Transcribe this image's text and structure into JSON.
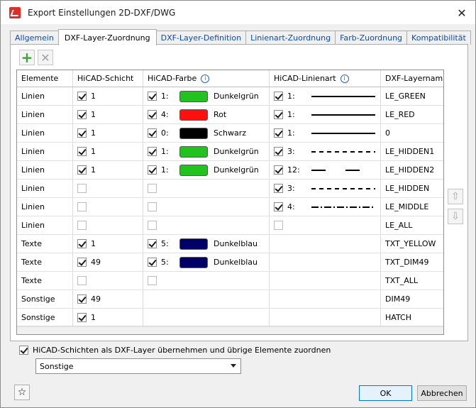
{
  "window": {
    "title": "Export Einstellungen 2D-DXF/DWG",
    "close_glyph": "✕"
  },
  "tabs": [
    "Allgemein",
    "DXF-Layer-Zuordnung",
    "DXF-Layer-Definition",
    "Linienart-Zuordnung",
    "Farb-Zuordnung",
    "Kompatibilität"
  ],
  "active_tab": "DXF-Layer-Zuordnung",
  "toolbar": {
    "add_icon": "plus-icon",
    "delete_icon": "x-icon",
    "add_glyph": "+",
    "delete_glyph": "✕"
  },
  "columns": [
    "Elemente",
    "HiCAD-Schicht",
    "HiCAD-Farbe",
    "HiCAD-Linienart",
    "DXF-Layernam"
  ],
  "info_glyph": "i",
  "rows": [
    {
      "element": "Linien",
      "layer_on": true,
      "layer": "1",
      "color_on": true,
      "color_idx": "1:",
      "color_hex": "#22c21f",
      "color_name": "Dunkelgrün",
      "line_on": true,
      "line_idx": "1:",
      "line_style": "solid",
      "dxf": "LE_GREEN"
    },
    {
      "element": "Linien",
      "layer_on": true,
      "layer": "1",
      "color_on": true,
      "color_idx": "4:",
      "color_hex": "#ff1010",
      "color_name": "Rot",
      "line_on": true,
      "line_idx": "1:",
      "line_style": "solid",
      "dxf": "LE_RED"
    },
    {
      "element": "Linien",
      "layer_on": true,
      "layer": "1",
      "color_on": true,
      "color_idx": "0:",
      "color_hex": "#000000",
      "color_name": "Schwarz",
      "line_on": true,
      "line_idx": "1:",
      "line_style": "solid",
      "dxf": "0"
    },
    {
      "element": "Linien",
      "layer_on": true,
      "layer": "1",
      "color_on": true,
      "color_idx": "1:",
      "color_hex": "#22c21f",
      "color_name": "Dunkelgrün",
      "line_on": true,
      "line_idx": "3:",
      "line_style": "dashed",
      "dxf": "LE_HIDDEN1"
    },
    {
      "element": "Linien",
      "layer_on": true,
      "layer": "1",
      "color_on": true,
      "color_idx": "1:",
      "color_hex": "#22c21f",
      "color_name": "Dunkelgrün",
      "line_on": true,
      "line_idx": "12:",
      "line_style": "longdash",
      "dxf": "LE_HIDDEN2"
    },
    {
      "element": "Linien",
      "layer_on": false,
      "layer": "",
      "color_on": false,
      "color_idx": "",
      "color_hex": "",
      "color_name": "",
      "line_on": true,
      "line_idx": "3:",
      "line_style": "dashed",
      "dxf": "LE_HIDDEN"
    },
    {
      "element": "Linien",
      "layer_on": false,
      "layer": "",
      "color_on": false,
      "color_idx": "",
      "color_hex": "",
      "color_name": "",
      "line_on": true,
      "line_idx": "4:",
      "line_style": "dashdot",
      "dxf": "LE_MIDDLE"
    },
    {
      "element": "Linien",
      "layer_on": false,
      "layer": "",
      "color_on": false,
      "color_idx": "",
      "color_hex": "",
      "color_name": "",
      "line_on": false,
      "line_idx": "",
      "line_style": "",
      "dxf": "LE_ALL"
    },
    {
      "element": "Texte",
      "layer_on": true,
      "layer": "1",
      "color_on": true,
      "color_idx": "5:",
      "color_hex": "#000066",
      "color_name": "Dunkelblau",
      "line_on": null,
      "line_idx": "",
      "line_style": "",
      "dxf": "TXT_YELLOW"
    },
    {
      "element": "Texte",
      "layer_on": true,
      "layer": "49",
      "color_on": true,
      "color_idx": "5:",
      "color_hex": "#000066",
      "color_name": "Dunkelblau",
      "line_on": null,
      "line_idx": "",
      "line_style": "",
      "dxf": "TXT_DIM49"
    },
    {
      "element": "Texte",
      "layer_on": false,
      "layer": "",
      "color_on": false,
      "color_idx": "",
      "color_hex": "",
      "color_name": "",
      "line_on": null,
      "line_idx": "",
      "line_style": "",
      "dxf": "TXT_ALL"
    },
    {
      "element": "Sonstige",
      "layer_on": true,
      "layer": "49",
      "color_on": null,
      "color_idx": "",
      "color_hex": "",
      "color_name": "",
      "line_on": null,
      "line_idx": "",
      "line_style": "",
      "dxf": "DIM49"
    },
    {
      "element": "Sonstige",
      "layer_on": true,
      "layer": "1",
      "color_on": null,
      "color_idx": "",
      "color_hex": "",
      "color_name": "",
      "line_on": null,
      "line_idx": "",
      "line_style": "",
      "dxf": "HATCH"
    }
  ],
  "side_buttons": {
    "up_icon": "arrow-up-icon",
    "down_icon": "arrow-down-icon",
    "up_glyph": "⇧",
    "down_glyph": "⇩"
  },
  "option": {
    "checked": true,
    "label": "HiCAD-Schichten als DXF-Layer übernehmen und übrige Elemente zuordnen"
  },
  "dropdown": {
    "value": "Sonstige"
  },
  "footer": {
    "star_icon": "star-icon",
    "star_glyph": "☆",
    "ok": "OK",
    "cancel": "Abbrechen"
  }
}
